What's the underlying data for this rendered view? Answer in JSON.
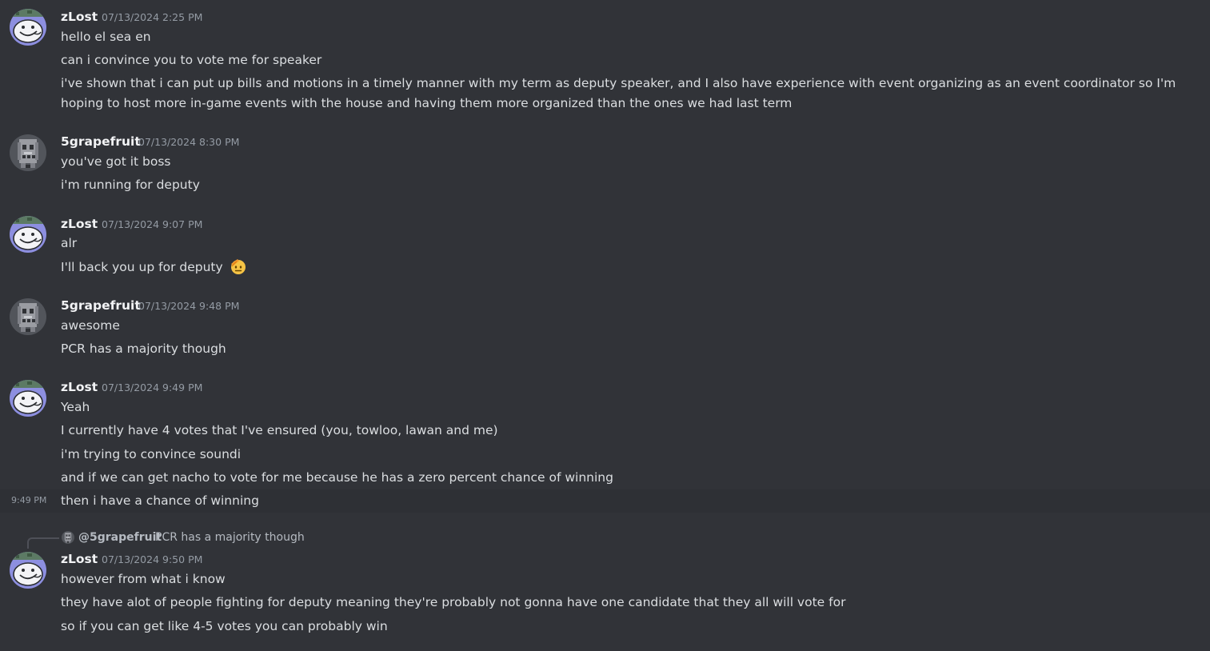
{
  "colors": {
    "background": "#313338",
    "username": "#f2f3f5",
    "text": "#dbdee1",
    "timestamp": "#949ba4",
    "hover_row": "#2e3035"
  },
  "messages": [
    {
      "author": "zLost",
      "timestamp": "07/13/2024 2:25 PM",
      "avatar_icon": "zlost-avatar-icon",
      "lines": [
        "hello el sea en",
        "can i convince you to vote me for speaker",
        "i've shown that i can put up bills and motions in a timely manner with my term as deputy speaker, and I also have experience with event organizing as an event coordinator so I'm hoping to host more in-game events with the house and having them more organized than the ones we had last term"
      ]
    },
    {
      "author": "5grapefruit",
      "timestamp": "07/13/2024 8:30 PM",
      "avatar_icon": "grapefruit-avatar-icon",
      "lines": [
        "you've got it boss",
        "i'm running for deputy"
      ]
    },
    {
      "author": "zLost",
      "timestamp": "07/13/2024 9:07 PM",
      "avatar_icon": "zlost-avatar-icon",
      "lines": [
        "alr",
        "I'll back you up for deputy"
      ],
      "emoji": "saluting-face-emoji-icon"
    },
    {
      "author": "5grapefruit",
      "timestamp": "07/13/2024 9:48 PM",
      "avatar_icon": "grapefruit-avatar-icon",
      "lines": [
        "awesome",
        "PCR has a majority though"
      ]
    },
    {
      "author": "zLost",
      "timestamp": "07/13/2024 9:49 PM",
      "avatar_icon": "zlost-avatar-icon",
      "lines": [
        "Yeah",
        "I currently have 4 votes that I've ensured (you, towloo, lawan and me)",
        "i'm trying to convince soundi",
        "and if we can get nacho to vote for me because he has a zero percent chance of winning",
        "then i have a chance of winning"
      ],
      "hover_timestamp": "9:49 PM"
    },
    {
      "reply": {
        "author": "@5grapefruit",
        "text": "PCR has a majority though"
      },
      "author": "zLost",
      "timestamp": "07/13/2024 9:50 PM",
      "avatar_icon": "zlost-avatar-icon",
      "lines": [
        "however from what i know",
        "they have alot of people fighting for deputy meaning they're probably not gonna have one candidate that they all will vote for",
        "so if you can get like 4-5 votes you can probably win"
      ]
    }
  ]
}
